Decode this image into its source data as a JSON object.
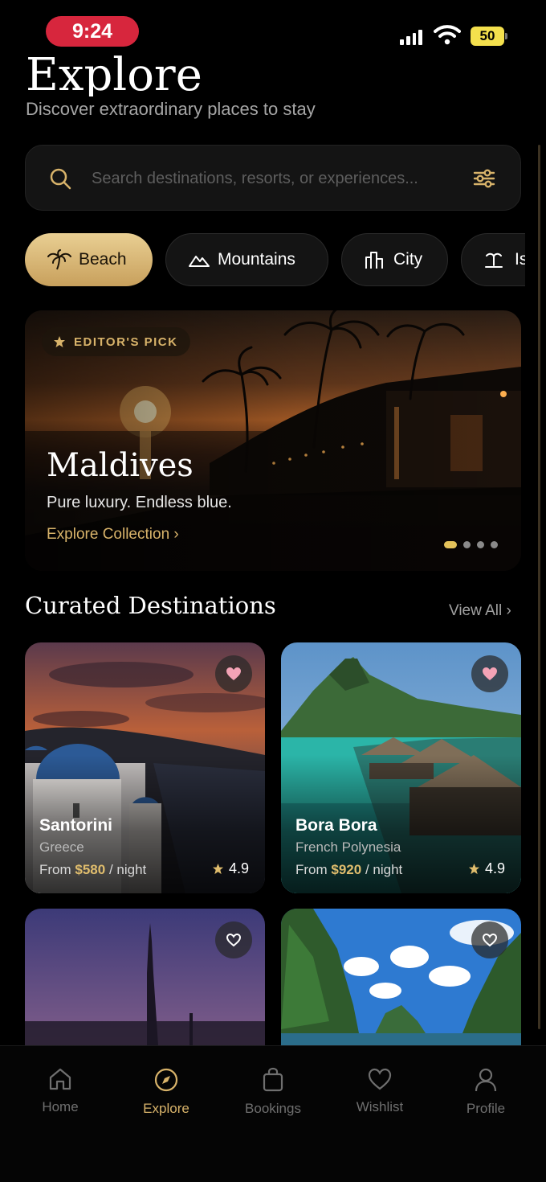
{
  "status_bar": {
    "time": "9:24",
    "battery": "50"
  },
  "header": {
    "title": "Explore",
    "subtitle": "Discover extraordinary places to stay"
  },
  "search": {
    "placeholder": "Search destinations, resorts, or experiences..."
  },
  "categories": [
    {
      "label": "Beach",
      "icon": "palm-tree-icon",
      "active": true
    },
    {
      "label": "Mountains",
      "icon": "mountain-icon",
      "active": false
    },
    {
      "label": "City",
      "icon": "city-icon",
      "active": false
    },
    {
      "label": "Is",
      "icon": "island-icon",
      "active": false
    }
  ],
  "hero": {
    "badge": "EDITOR'S PICK",
    "title": "Maldives",
    "tagline": "Pure luxury. Endless blue.",
    "link": "Explore Collection ›",
    "slides": 4,
    "active_slide": 1
  },
  "section": {
    "title": "Curated Destinations",
    "view_all": "View All ›"
  },
  "destinations": [
    {
      "name": "Santorini",
      "country": "Greece",
      "price_prefix": "From ",
      "price": "$580",
      "price_suffix": " / night",
      "rating": "4.9",
      "favorited": true
    },
    {
      "name": "Bora Bora",
      "country": "French Polynesia",
      "price_prefix": "From ",
      "price": "$920",
      "price_suffix": " / night",
      "rating": "4.9",
      "favorited": true
    },
    {
      "name": "",
      "country": "",
      "price": "",
      "rating": "",
      "favorited": false
    },
    {
      "name": "",
      "country": "",
      "price": "",
      "rating": "",
      "favorited": false
    }
  ],
  "tab_bar": {
    "tabs": [
      {
        "label": "Home",
        "icon": "home-icon"
      },
      {
        "label": "Explore",
        "icon": "compass-icon",
        "active": true
      },
      {
        "label": "Bookings",
        "icon": "bag-icon"
      },
      {
        "label": "Wishlist",
        "icon": "heart-icon"
      },
      {
        "label": "Profile",
        "icon": "user-icon"
      }
    ]
  },
  "colors": {
    "accent_gold": "#d8b36a",
    "background": "#000000",
    "time_pill": "#d7263d",
    "favorite_pink": "#f4a3b6"
  }
}
